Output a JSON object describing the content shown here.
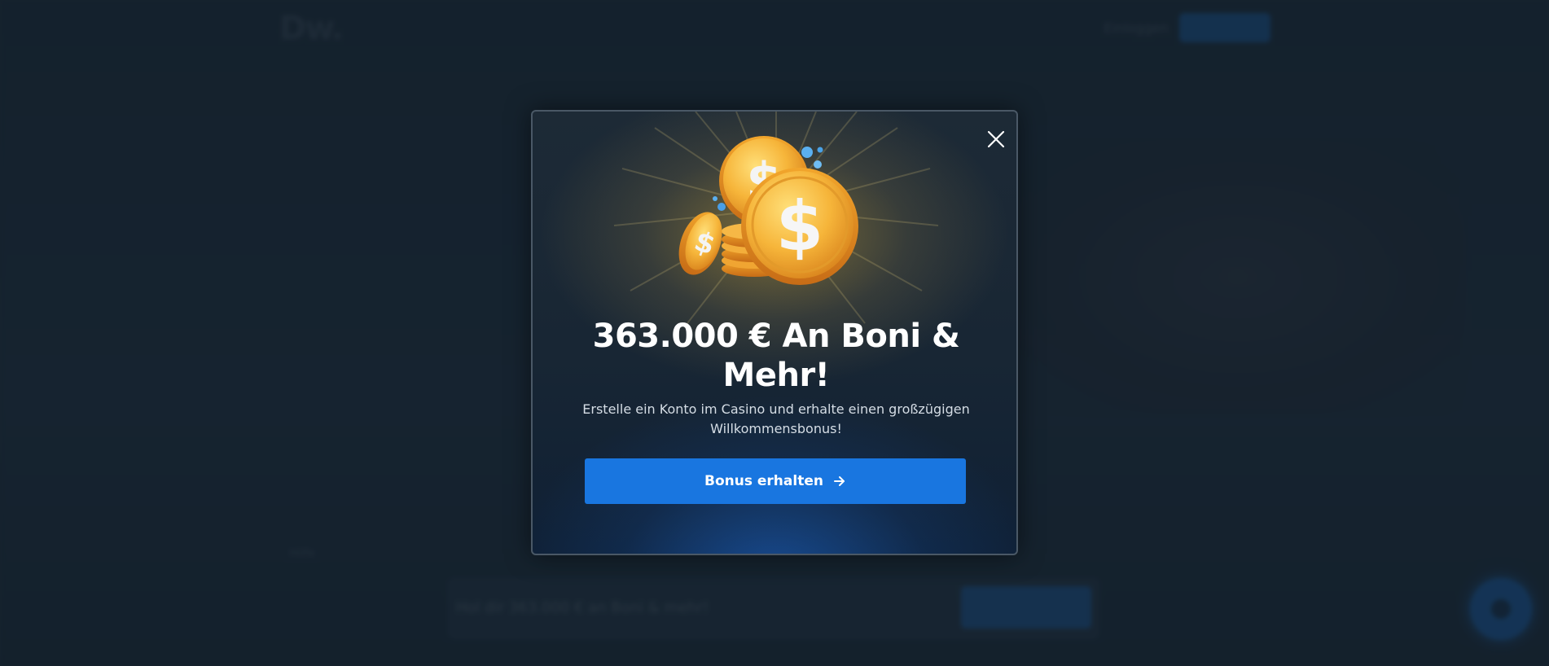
{
  "background": {
    "logo_text": "Dw.",
    "login_label": "Einloggen",
    "bottom_link": "Hilfe",
    "bar_text": "Hol dir 363.000 € an Boni & mehr!",
    "bar_button": "Bonus holen"
  },
  "modal": {
    "title": "363.000 € An Boni & Mehr!",
    "text": "Erstelle ein Konto im Casino und erhalte einen großzügigen Willkommensbonus!",
    "cta_label": "Bonus erhalten",
    "icons": {
      "close": "close-icon",
      "illustration": "gold-coins-illustration",
      "cta_arrow": "arrow-right-icon",
      "chat": "chat-icon"
    }
  },
  "colors": {
    "accent": "#1976e0",
    "gold": "#f3b233",
    "background": "#1e2d3b"
  }
}
